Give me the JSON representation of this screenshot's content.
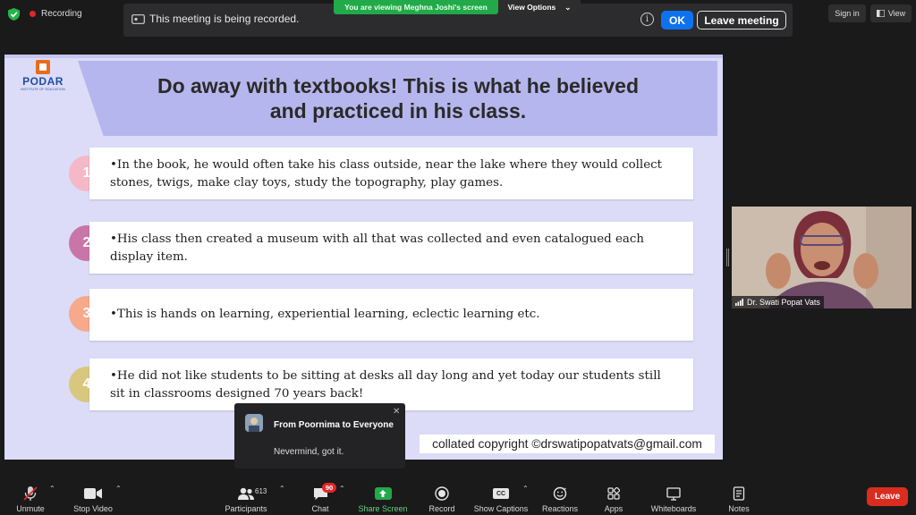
{
  "topbar": {
    "recording_label": "Recording",
    "banner_text": "You are viewing Meghna Joshi's screen",
    "view_options_label": "View Options",
    "sign_in_label": "Sign in",
    "view_label": "View"
  },
  "recording_notice": {
    "text": "This meeting is being recorded.",
    "ok_label": "OK",
    "leave_label": "Leave meeting"
  },
  "slide": {
    "logo_name": "PODAR",
    "logo_sub": "INSTITUTE OF EDUCATION",
    "title_line1": "Do away with textbooks! This is what he believed",
    "title_line2": "and practiced in his class.",
    "items": [
      {
        "num": "1",
        "color": "#f5b8c7",
        "text": "•In the book, he would often take his class outside, near the lake where they would collect stones, twigs, make clay toys, study the topography, play games."
      },
      {
        "num": "2",
        "color": "#c975a8",
        "text": "•His class then created a museum with all that was collected and even catalogued each display item."
      },
      {
        "num": "3",
        "color": "#f6a98b",
        "text": "•This is hands on learning, experiential learning, eclectic learning etc."
      },
      {
        "num": "4",
        "color": "#d8c77e",
        "text": "•He did not like students to be sitting at desks all day long and yet today our students still sit in classrooms designed 70 years back!"
      }
    ],
    "copyright": "collated copyright ©drswatipopatvats@gmail.com"
  },
  "video": {
    "participant_name": "Dr. Swati Popat Vats"
  },
  "chat_popup": {
    "from": "From Poornima to Everyone",
    "message": "Nevermind, got it."
  },
  "toolbar": {
    "unmute": "Unmute",
    "stop_video": "Stop Video",
    "participants": "Participants",
    "participant_count": "613",
    "chat": "Chat",
    "chat_badge": "90",
    "share_screen": "Share Screen",
    "record": "Record",
    "show_captions": "Show Captions",
    "captions_icon_text": "CC",
    "reactions": "Reactions",
    "apps": "Apps",
    "whiteboards": "Whiteboards",
    "notes": "Notes",
    "leave": "Leave"
  },
  "colors": {
    "zoom_blue": "#0e72ed",
    "share_green": "#21a94a",
    "leave_red": "#d92d20",
    "slide_bg": "#dcdcf8",
    "title_band": "#b6b6ee"
  }
}
